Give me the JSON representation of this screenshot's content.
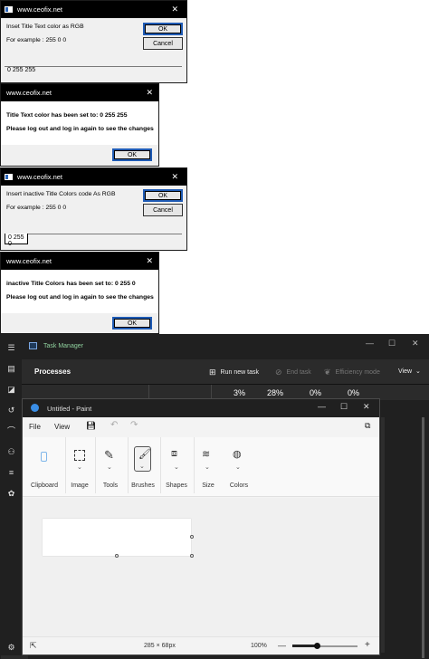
{
  "dialog1": {
    "title": "www.ceofix.net",
    "prompt": "Inset Title Text color as RGB",
    "example": "For example : 255 0 0",
    "ok_label": "OK",
    "cancel_label": "Cancel",
    "input_value": "0 255 255"
  },
  "dialog2": {
    "title": "www.ceofix.net",
    "message1": "Title Text color has been set to: 0 255 255",
    "message2": "Please log out and log in again to see the changes",
    "ok_label": "OK"
  },
  "dialog3": {
    "title": "www.ceofix.net",
    "prompt": "Insert inactive Title Colors code As RGB",
    "example": "For example : 255 0 0",
    "ok_label": "OK",
    "cancel_label": "Cancel",
    "input_value": "0 255 0"
  },
  "dialog4": {
    "title": "www.ceofix.net",
    "message1": "inactive Title Colors has been set to: 0 255 0",
    "message2": "Please log out and log in again to see the changes",
    "ok_label": "OK"
  },
  "task_manager": {
    "title": "Task Manager",
    "page": "Processes",
    "run_new_task": "Run new task",
    "end_task": "End task",
    "efficiency_mode": "Efficiency mode",
    "view": "View",
    "cpu": "3%",
    "memory": "28%",
    "disk": "0%",
    "network": "0%"
  },
  "paint": {
    "title": "Untitled - Paint",
    "menu": {
      "file": "File",
      "view": "View"
    },
    "groups": {
      "clipboard": "Clipboard",
      "image": "Image",
      "tools": "Tools",
      "brushes": "Brushes",
      "shapes": "Shapes",
      "size": "Size",
      "colors": "Colors"
    },
    "canvas_size": "285 × 68px",
    "zoom": "100%"
  },
  "colors": {
    "dialog_bg": "#f0f0f0",
    "titlebar": "#000000",
    "tm_bg": "#202020",
    "paint_bg": "#f3f3f3",
    "accent": "#1f5bb5"
  }
}
